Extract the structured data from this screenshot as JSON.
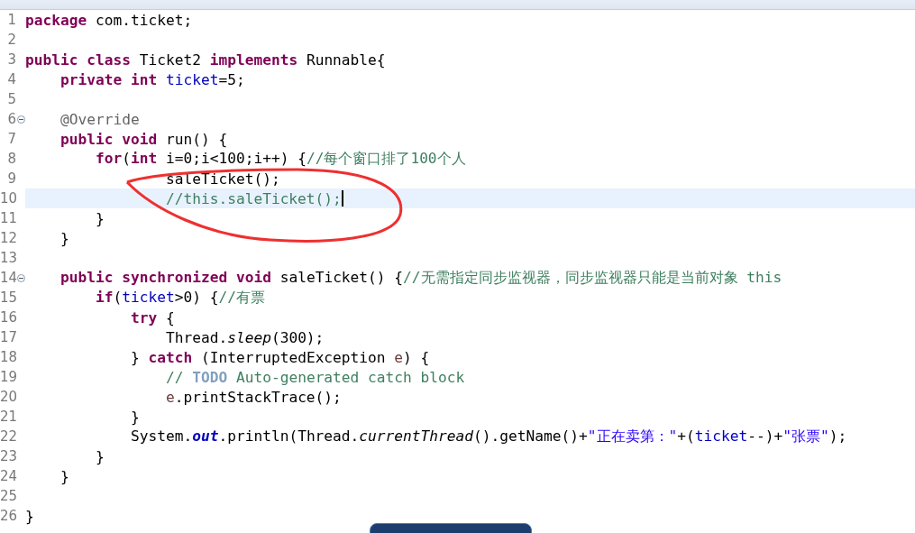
{
  "editor": {
    "lines": [
      {
        "n": "1",
        "current": false,
        "tokens": [
          {
            "kind": "kw",
            "t": "package"
          },
          {
            "kind": "p",
            "t": " com.ticket;"
          }
        ]
      },
      {
        "n": "2",
        "current": false
      },
      {
        "n": "3",
        "current": false,
        "tokens": [
          {
            "kind": "kw",
            "t": "public"
          },
          {
            "kind": "kw",
            "t": " class"
          },
          {
            "kind": "p",
            "t": " Ticket2"
          },
          {
            "kind": "kw",
            "t": " implements"
          },
          {
            "kind": "p",
            "t": " Runnable{"
          }
        ]
      },
      {
        "n": "4",
        "current": false,
        "tokens": [
          {
            "kind": "kw",
            "t": "    private"
          },
          {
            "kind": "kw",
            "t": " int"
          },
          {
            "kind": "f",
            "t": " ticket"
          },
          {
            "kind": "p",
            "t": "=5;"
          }
        ]
      },
      {
        "n": "5",
        "current": false
      },
      {
        "n": "6",
        "current": false,
        "fold": {
          "expanded": true
        },
        "tokens": [
          {
            "kind": "a",
            "t": "    @Override"
          }
        ]
      },
      {
        "n": "7",
        "current": false,
        "tokens": [
          {
            "kind": "kw",
            "t": "    public"
          },
          {
            "kind": "kw",
            "t": " void"
          },
          {
            "kind": "p",
            "t": " run() {"
          }
        ]
      },
      {
        "n": "8",
        "current": false,
        "tokens": [
          {
            "kind": "kw",
            "t": "        for"
          },
          {
            "kind": "p",
            "t": "("
          },
          {
            "kind": "kw",
            "t": "int"
          },
          {
            "kind": "p",
            "t": " i=0;i<100;i++) {"
          },
          {
            "kind": "c",
            "t": "//每个窗口排了100个人"
          }
        ]
      },
      {
        "n": "9",
        "current": false,
        "tokens": [
          {
            "kind": "p",
            "t": "                saleTicket();"
          }
        ]
      },
      {
        "n": "10",
        "current": true,
        "tokens": [
          {
            "kind": "c",
            "t": "                //this.saleTicket();"
          }
        ]
      },
      {
        "n": "11",
        "current": false,
        "tokens": [
          {
            "kind": "p",
            "t": "        }"
          }
        ]
      },
      {
        "n": "12",
        "current": false,
        "tokens": [
          {
            "kind": "p",
            "t": "    }"
          }
        ]
      },
      {
        "n": "13",
        "current": false
      },
      {
        "n": "14",
        "current": false,
        "fold": {
          "expanded": true
        },
        "tokens": [
          {
            "kind": "kw",
            "t": "    public"
          },
          {
            "kind": "kw",
            "t": " synchronized"
          },
          {
            "kind": "kw",
            "t": " void"
          },
          {
            "kind": "p",
            "t": " saleTicket() {"
          },
          {
            "kind": "c",
            "t": "//无需指定同步监视器，同步监视器只能是当前对象 this"
          }
        ]
      },
      {
        "n": "15",
        "current": false,
        "tokens": [
          {
            "kind": "kw",
            "t": "        if"
          },
          {
            "kind": "p",
            "t": "("
          },
          {
            "kind": "f",
            "t": "ticket"
          },
          {
            "kind": "p",
            "t": ">0) {"
          },
          {
            "kind": "c",
            "t": "//有票"
          }
        ]
      },
      {
        "n": "16",
        "current": false,
        "tokens": [
          {
            "kind": "kw",
            "t": "            try"
          },
          {
            "kind": "p",
            "t": " {"
          }
        ]
      },
      {
        "n": "17",
        "current": false,
        "tokens": [
          {
            "kind": "p",
            "t": "                Thread."
          },
          {
            "kind": "sm",
            "t": "sleep"
          },
          {
            "kind": "p",
            "t": "(300);"
          }
        ]
      },
      {
        "n": "18",
        "current": false,
        "tokens": [
          {
            "kind": "p",
            "t": "            }"
          },
          {
            "kind": "kw",
            "t": " catch"
          },
          {
            "kind": "p",
            "t": " (InterruptedException"
          },
          {
            "kind": "v",
            "t": " e"
          },
          {
            "kind": "p",
            "t": ") {"
          }
        ]
      },
      {
        "n": "19",
        "current": false,
        "tokens": [
          {
            "kind": "c",
            "t": "                //"
          },
          {
            "kind": "todo",
            "t": " TODO"
          },
          {
            "kind": "c",
            "t": " Auto-generated catch block"
          }
        ]
      },
      {
        "n": "20",
        "current": false,
        "tokens": [
          {
            "kind": "v",
            "t": "                e"
          },
          {
            "kind": "p",
            "t": ".printStackTrace();"
          }
        ]
      },
      {
        "n": "21",
        "current": false,
        "tokens": [
          {
            "kind": "p",
            "t": "            }"
          }
        ]
      },
      {
        "n": "22",
        "current": false,
        "tokens": [
          {
            "kind": "p",
            "t": "            System."
          },
          {
            "kind": "sf",
            "t": "out"
          },
          {
            "kind": "p",
            "t": ".println(Thread."
          },
          {
            "kind": "sm",
            "t": "currentThread"
          },
          {
            "kind": "p",
            "t": "().getName()+"
          },
          {
            "kind": "s",
            "t": "\"正在卖第：\""
          },
          {
            "kind": "p",
            "t": "+("
          },
          {
            "kind": "f",
            "t": "ticket"
          },
          {
            "kind": "p",
            "t": "--)+"
          },
          {
            "kind": "s",
            "t": "\"张票\""
          },
          {
            "kind": "p",
            "t": ");"
          }
        ]
      },
      {
        "n": "23",
        "current": false,
        "tokens": [
          {
            "kind": "p",
            "t": "        }"
          }
        ]
      },
      {
        "n": "24",
        "current": false,
        "tokens": [
          {
            "kind": "p",
            "t": "    }"
          }
        ]
      },
      {
        "n": "25",
        "current": false
      },
      {
        "n": "26",
        "current": false,
        "tokens": [
          {
            "kind": "p",
            "t": "}"
          }
        ]
      }
    ]
  }
}
